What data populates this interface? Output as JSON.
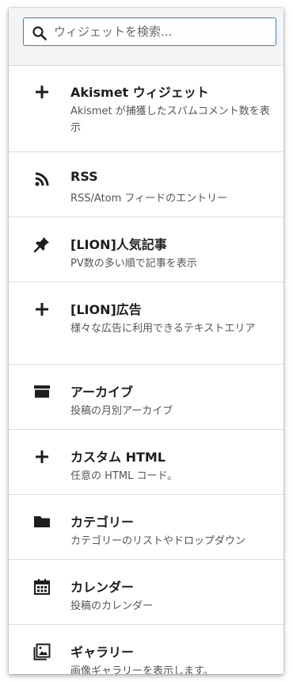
{
  "search": {
    "placeholder": "ウィジェットを検索..."
  },
  "widgets": [
    {
      "icon": "plus-icon",
      "title": "Akismet ウィジェット",
      "desc": "Akismet が捕獲したスパムコメント数を表示"
    },
    {
      "icon": "rss-icon",
      "title": "RSS",
      "desc": "RSS/Atom フィードのエントリー"
    },
    {
      "icon": "pin-icon",
      "title": "[LION]人気記事",
      "desc": "PV数の多い順で記事を表示"
    },
    {
      "icon": "plus-icon",
      "title": "[LION]広告",
      "desc": "様々な広告に利用できるテキストエリア"
    },
    {
      "icon": "archive-icon",
      "title": "アーカイブ",
      "desc": "投稿の月別アーカイブ"
    },
    {
      "icon": "plus-icon",
      "title": "カスタム HTML",
      "desc": "任意の HTML コード。"
    },
    {
      "icon": "folder-icon",
      "title": "カテゴリー",
      "desc": "カテゴリーのリストやドロップダウン"
    },
    {
      "icon": "calendar-icon",
      "title": "カレンダー",
      "desc": "投稿のカレンダー"
    },
    {
      "icon": "gallery-icon",
      "title": "ギャラリー",
      "desc": "画像ギャラリーを表示します。"
    }
  ]
}
